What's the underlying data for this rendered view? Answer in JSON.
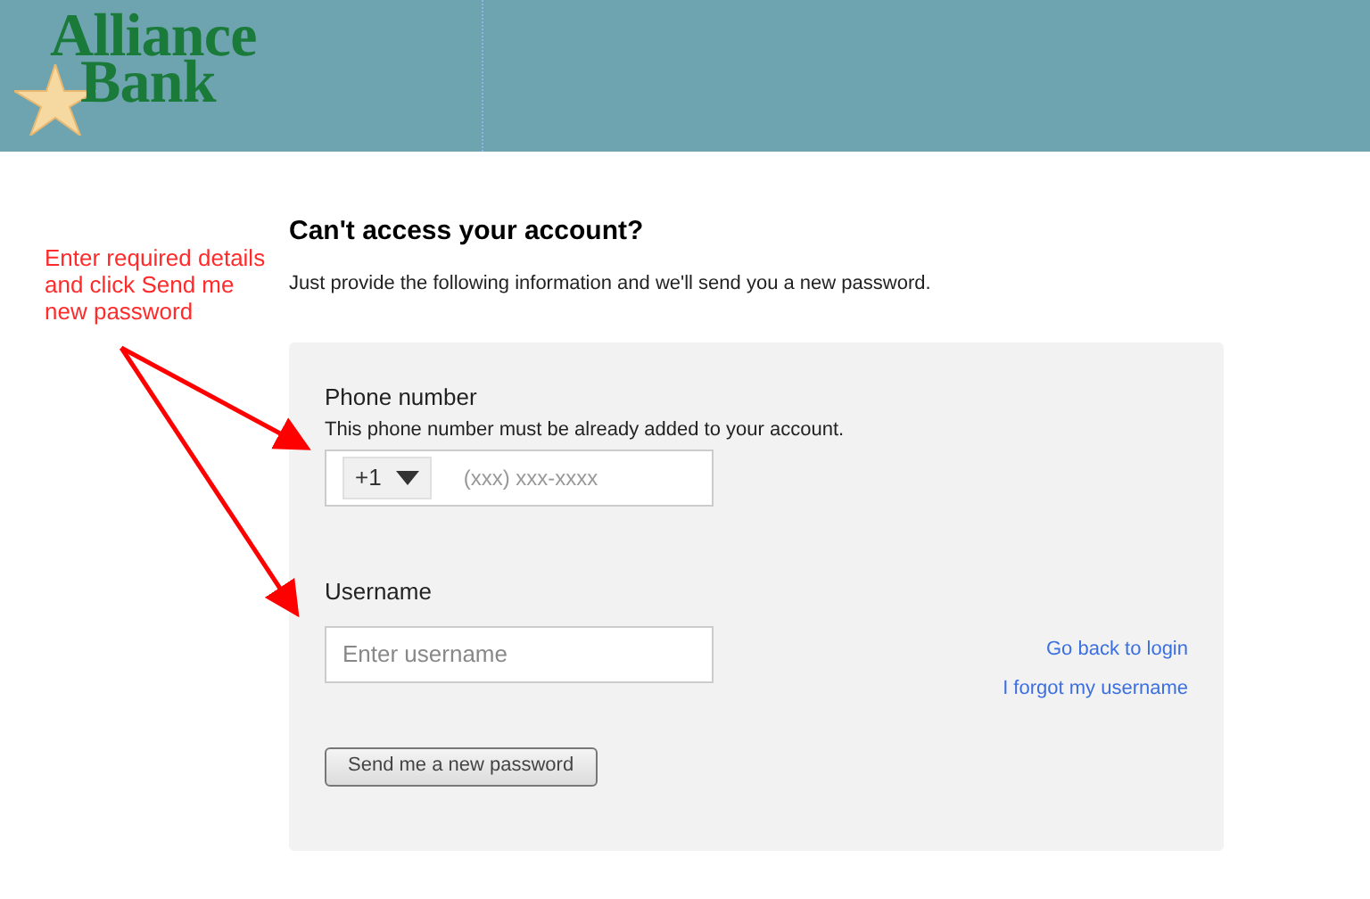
{
  "header": {
    "logo": {
      "line_1": "Alliance",
      "line_2": "Bank"
    }
  },
  "annotation": {
    "text": "Enter required details and click Send me new password"
  },
  "title": "Can't access your account?",
  "subtitle": "Just provide the following information and we'll send you a new password.",
  "form": {
    "phone": {
      "label": "Phone number",
      "hint": "This phone number must be already added to your account.",
      "country_code": "+1",
      "placeholder": "(xxx) xxx-xxxx"
    },
    "username": {
      "label": "Username",
      "placeholder": "Enter username"
    },
    "submit": "Send me a new password"
  },
  "links": [
    "Go back to login",
    "I forgot my username"
  ]
}
